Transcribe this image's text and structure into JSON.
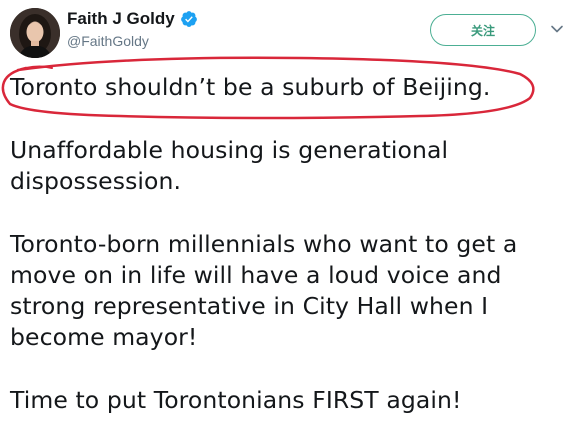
{
  "profile": {
    "display_name": "Faith J Goldy",
    "handle": "@FaithGoldy",
    "verified": true,
    "avatar_icon": "user-avatar-photo"
  },
  "actions": {
    "follow_label": "关注",
    "menu_icon": "chevron-down-icon"
  },
  "tweet": {
    "paragraphs": [
      [
        "Toronto shouldn’t be a suburb of Beijing."
      ],
      [
        "Unaffordable housing is generational",
        "dispossession."
      ],
      [
        "Toronto-born millennials who want to get a",
        "move on in life will have a loud voice and",
        "strong representative in City Hall when I",
        "become mayor!"
      ],
      [
        "Time to put Torontonians FIRST again!"
      ]
    ]
  },
  "colors": {
    "text": "#14171a",
    "secondary_text": "#657786",
    "verified_badge": "#1da1f2",
    "follow_border": "#4caf94",
    "follow_text": "#3a9a7c",
    "annotation_circle": "#d9273a"
  }
}
